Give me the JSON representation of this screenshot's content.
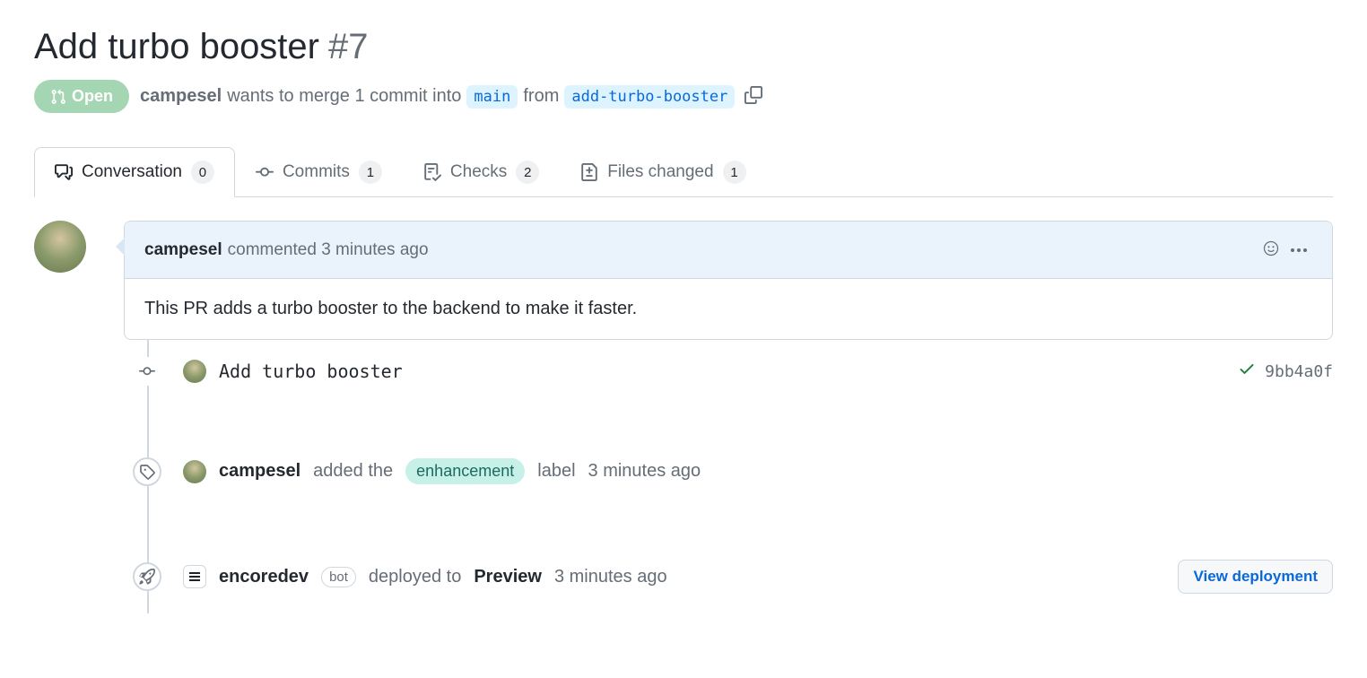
{
  "pr": {
    "title": "Add turbo booster",
    "number": "#7",
    "state": "Open",
    "author": "campesel",
    "merge_text_1": "wants to merge 1 commit into",
    "base_branch": "main",
    "merge_text_2": "from",
    "head_branch": "add-turbo-booster"
  },
  "tabs": {
    "conversation": {
      "label": "Conversation",
      "count": "0"
    },
    "commits": {
      "label": "Commits",
      "count": "1"
    },
    "checks": {
      "label": "Checks",
      "count": "2"
    },
    "files": {
      "label": "Files changed",
      "count": "1"
    }
  },
  "comment": {
    "author": "campesel",
    "verb": "commented",
    "time": "3 minutes ago",
    "body": "This PR adds a turbo booster to the backend to make it faster."
  },
  "commit": {
    "message": "Add turbo booster",
    "sha": "9bb4a0f"
  },
  "label_event": {
    "actor": "campesel",
    "text_1": "added the",
    "label": "enhancement",
    "text_2": "label",
    "time": "3 minutes ago"
  },
  "deploy_event": {
    "actor": "encoredev",
    "bot": "bot",
    "text_1": "deployed to",
    "env": "Preview",
    "time": "3 minutes ago",
    "button": "View deployment"
  }
}
